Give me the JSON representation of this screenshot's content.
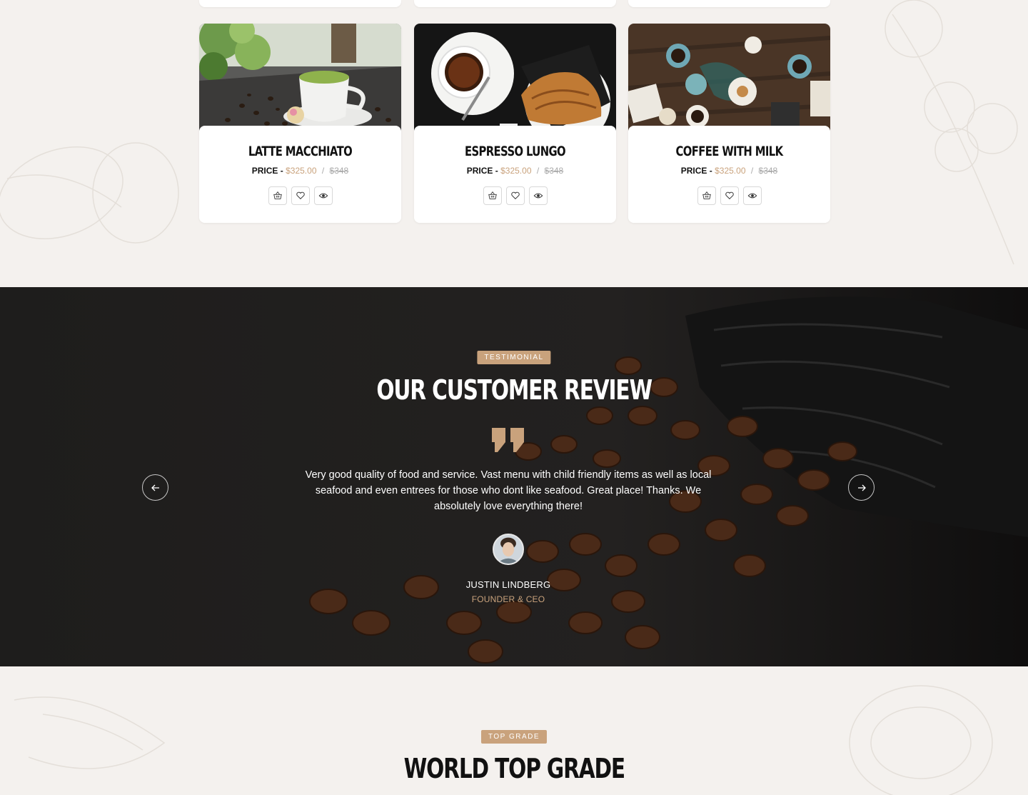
{
  "colors": {
    "accent": "#c9a27c",
    "page_bg": "#f4f1ee",
    "dark_bg": "#1b1a19"
  },
  "products": [
    {
      "name": "Latte Macchiato",
      "price_label": "PRICE -",
      "price": "$325.00",
      "separator": "/",
      "old_price": "$348",
      "image": "latte-macchiato-photo"
    },
    {
      "name": "Espresso Lungo",
      "price_label": "PRICE -",
      "price": "$325.00",
      "separator": "/",
      "old_price": "$348",
      "image": "espresso-croissant-photo"
    },
    {
      "name": "Coffee With Milk",
      "price_label": "PRICE -",
      "price": "$325.00",
      "separator": "/",
      "old_price": "$348",
      "image": "coffee-table-photo"
    }
  ],
  "product_actions": [
    "basket-icon",
    "heart-icon",
    "eye-icon"
  ],
  "testimonial": {
    "badge": "Testimonial",
    "title": "Our Customer Review",
    "quote_icon": "quote-icon",
    "text": "Very good quality of food and service. Vast menu with child friendly items as well as local seafood and even entrees for those who dont like seafood. Great place! Thanks. We absolutely love everything there!",
    "author": "Justin Lindberg",
    "role": "Founder & CEO",
    "prev_icon": "arrow-left-icon",
    "next_icon": "arrow-right-icon"
  },
  "top_grade": {
    "badge": "Top Grade",
    "title": "World Top Grade"
  }
}
